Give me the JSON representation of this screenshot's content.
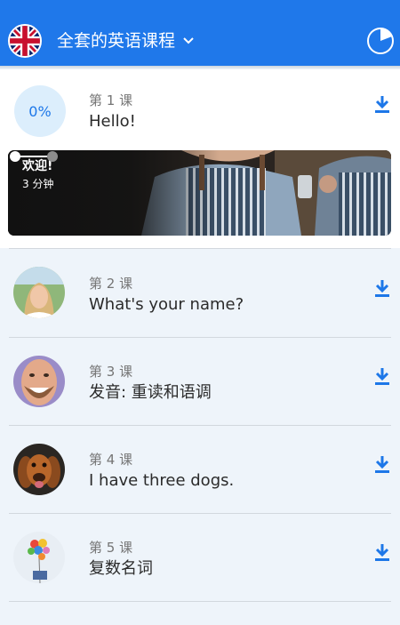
{
  "header": {
    "course_title": "全套的英语课程",
    "flag_icon": "uk-flag-icon",
    "dropdown_icon": "chevron-down-icon",
    "progress_icon": "progress-pie-icon",
    "accent_color": "#1f78ea"
  },
  "current_lesson": {
    "progress_percent": "0%",
    "number_label": "第 1 课",
    "title": "Hello!",
    "download_icon": "download-icon",
    "banner": {
      "title": "欢迎!",
      "duration": "3 分钟",
      "slider_position": 1
    }
  },
  "lessons": [
    {
      "number_label": "第 2 课",
      "title": "What's your name?",
      "image": "girl-portrait"
    },
    {
      "number_label": "第 3 课",
      "title": "发音: 重读和语调",
      "image": "smiling-man"
    },
    {
      "number_label": "第 4 课",
      "title": "I have three dogs.",
      "image": "dog"
    },
    {
      "number_label": "第 5 课",
      "title": "复数名词",
      "image": "balloons"
    }
  ]
}
